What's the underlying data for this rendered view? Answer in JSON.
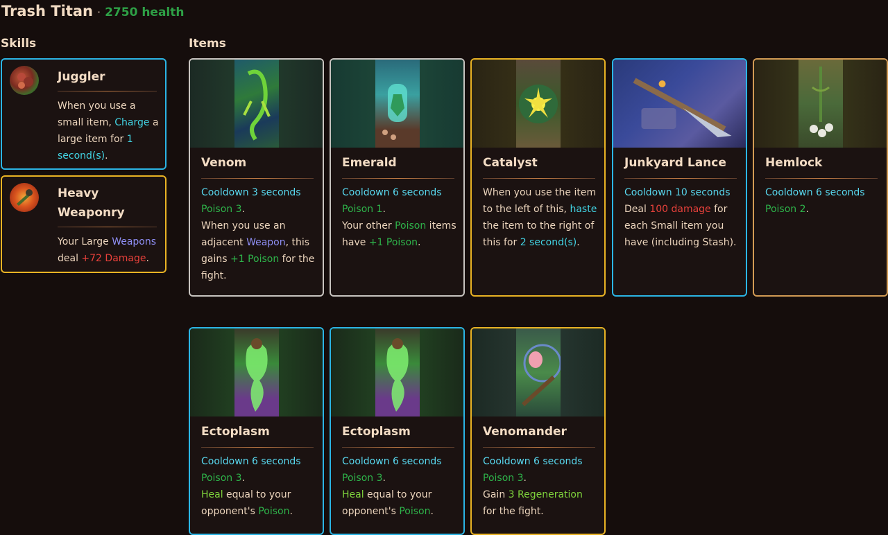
{
  "header": {
    "title": "Trash Titan",
    "separator": "·",
    "health": "2750 health"
  },
  "sections": {
    "skills_label": "Skills",
    "items_label": "Items"
  },
  "skills": [
    {
      "name": "Juggler",
      "desc": [
        "When you use a small item, ",
        "Charge",
        " a large item for ",
        "1 second(s)",
        "."
      ]
    },
    {
      "name_line1": "Heavy",
      "name_line2": "Weaponry",
      "desc": [
        "Your Large ",
        "Weapons",
        " deal ",
        "+72 Damage",
        "."
      ]
    }
  ],
  "items": [
    {
      "name": "Venom",
      "cooldown": "Cooldown 3 seconds",
      "poison": "Poison 3",
      "desc": [
        "When you use an adjacent ",
        "Weapon",
        ", this gains ",
        "+1 Poison",
        " for the fight."
      ]
    },
    {
      "name": "Emerald",
      "cooldown": "Cooldown 6 seconds",
      "poison": "Poison 1",
      "desc": [
        "Your other ",
        "Poison",
        " items have ",
        "+1 Poison",
        "."
      ]
    },
    {
      "name": "Catalyst",
      "desc": [
        "When you use the item to the left of this, ",
        "haste",
        " the item to the right of this for ",
        "2 second(s)",
        "."
      ]
    },
    {
      "name": "Junkyard Lance",
      "cooldown": "Cooldown 10 seconds",
      "desc": [
        "Deal ",
        "100 damage",
        " for each Small item you have (including Stash)."
      ]
    },
    {
      "name": "Hemlock",
      "cooldown": "Cooldown 6 seconds",
      "poison": "Poison 2"
    },
    {
      "name": "Ectoplasm",
      "cooldown": "Cooldown 6 seconds",
      "poison": "Poison 3",
      "desc": [
        "Heal",
        " equal to your opponent's ",
        "Poison",
        "."
      ]
    },
    {
      "name": "Ectoplasm",
      "cooldown": "Cooldown 6 seconds",
      "poison": "Poison 3",
      "desc": [
        "Heal",
        " equal to your opponent's ",
        "Poison",
        "."
      ]
    },
    {
      "name": "Venomander",
      "cooldown": "Cooldown 6 seconds",
      "poison": "Poison 3",
      "desc": [
        "Gain ",
        "3 Regeneration",
        " for the fight."
      ]
    }
  ],
  "colors": {
    "background": "#150d0c",
    "health": "#2ea046",
    "keyword_cyan": "#42d4e4",
    "keyword_green": "#2eb34a",
    "keyword_red": "#e9413b",
    "keyword_purple": "#8f8ff5",
    "border_cyan": "#2bb5e5",
    "border_gold": "#e9b324",
    "border_silver": "#c8c4c0",
    "border_bronze": "#d19a54"
  }
}
